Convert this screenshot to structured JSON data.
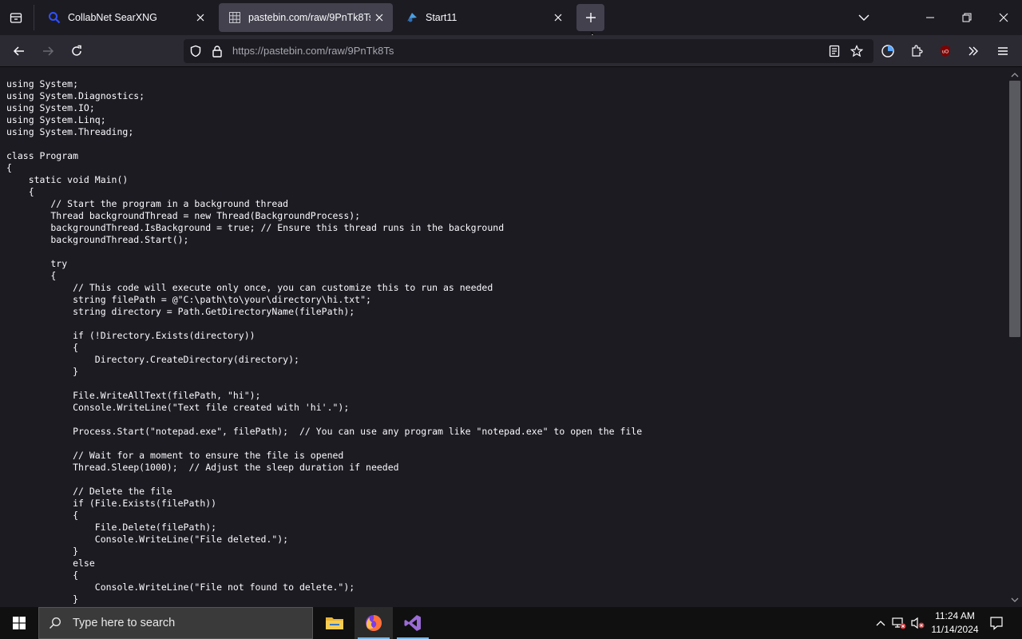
{
  "browser": {
    "tabs": [
      {
        "title": "CollabNet SearXNG",
        "active": false,
        "icon": "searxng-magnifier-icon"
      },
      {
        "title": "pastebin.com/raw/9PnTk8Ts",
        "active": true,
        "icon": "pastebin-grid-icon"
      },
      {
        "title": "Start11",
        "active": false,
        "icon": "start11-icon"
      }
    ],
    "url": "https://pastebin.com/raw/9PnTk8Ts"
  },
  "code_lines": [
    "using System;",
    "using System.Diagnostics;",
    "using System.IO;",
    "using System.Linq;",
    "using System.Threading;",
    "",
    "class Program",
    "{",
    "    static void Main()",
    "    {",
    "        // Start the program in a background thread",
    "        Thread backgroundThread = new Thread(BackgroundProcess);",
    "        backgroundThread.IsBackground = true; // Ensure this thread runs in the background",
    "        backgroundThread.Start();",
    "",
    "        try",
    "        {",
    "            // This code will execute only once, you can customize this to run as needed",
    "            string filePath = @\"C:\\path\\to\\your\\directory\\hi.txt\";",
    "            string directory = Path.GetDirectoryName(filePath);",
    "",
    "            if (!Directory.Exists(directory))",
    "            {",
    "                Directory.CreateDirectory(directory);",
    "            }",
    "",
    "            File.WriteAllText(filePath, \"hi\");",
    "            Console.WriteLine(\"Text file created with 'hi'.\");",
    "",
    "            Process.Start(\"notepad.exe\", filePath);  // You can use any program like \"notepad.exe\" to open the file",
    "",
    "            // Wait for a moment to ensure the file is opened",
    "            Thread.Sleep(1000);  // Adjust the sleep duration if needed",
    "",
    "            // Delete the file",
    "            if (File.Exists(filePath))",
    "            {",
    "                File.Delete(filePath);",
    "                Console.WriteLine(\"File deleted.\");",
    "            }",
    "            else",
    "            {",
    "                Console.WriteLine(\"File not found to delete.\");",
    "            }"
  ],
  "taskbar": {
    "search_placeholder": "Type here to search",
    "time": "11:24 AM",
    "date": "11/14/2024",
    "apps": [
      "file-explorer-icon",
      "firefox-icon",
      "visual-studio-icon"
    ]
  },
  "colors": {
    "background": "#1c1b22",
    "toolbar": "#2b2a33",
    "active_tab": "#42414d",
    "text": "#fbfbfe"
  }
}
